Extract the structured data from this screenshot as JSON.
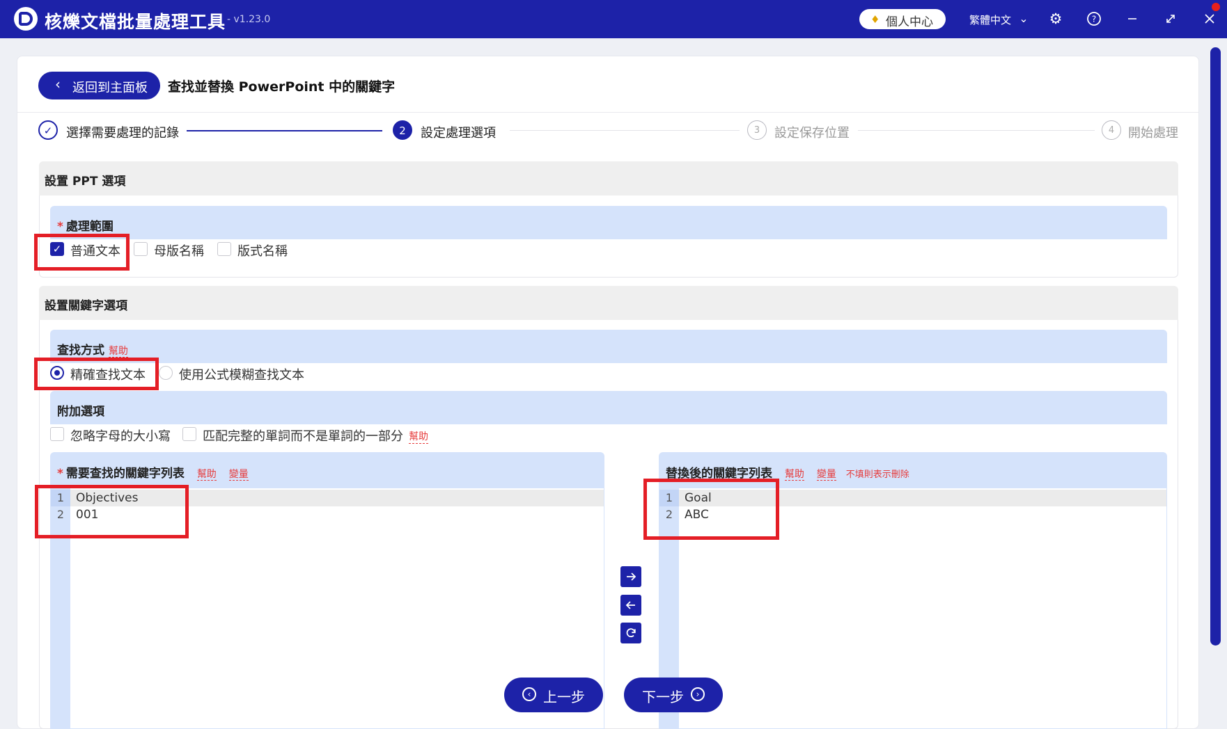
{
  "app": {
    "title": "核爍文檔批量處理工具",
    "version": "- v1.23.0",
    "vip_label": "個人中心",
    "language": "繁體中文"
  },
  "icons": {
    "vip": "diamond-icon",
    "language": "chevron-down-icon",
    "settings": "gear-icon",
    "help": "question-icon",
    "minimize": "minimize-icon",
    "maximize": "maximize-icon",
    "close": "close-icon"
  },
  "colors": {
    "brand": "#1d22a8",
    "highlight": "#e41e26",
    "section_bg": "#d5e3fb"
  },
  "header": {
    "back_label": "返回到主面板",
    "page_title": "查找並替換 PowerPoint 中的關鍵字"
  },
  "steps": [
    {
      "num": "✓",
      "label": "選擇需要處理的記錄",
      "state": "done"
    },
    {
      "num": "2",
      "label": "設定處理選項",
      "state": "active"
    },
    {
      "num": "3",
      "label": "設定保存位置",
      "state": "idle"
    },
    {
      "num": "4",
      "label": "開始處理",
      "state": "idle"
    }
  ],
  "ppt_section": {
    "title": "設置 PPT 選項",
    "scope": {
      "required": "*",
      "title": "處理範圍",
      "options": [
        {
          "label": "普通文本",
          "checked": true
        },
        {
          "label": "母版名稱",
          "checked": false
        },
        {
          "label": "版式名稱",
          "checked": false
        }
      ]
    }
  },
  "keyword_section": {
    "title": "設置關鍵字選項",
    "find_mode": {
      "title": "查找方式",
      "help": "幫助",
      "options": [
        {
          "label": "精確查找文本",
          "checked": true
        },
        {
          "label": "使用公式模糊查找文本",
          "checked": false
        }
      ]
    },
    "extra": {
      "title": "附加選項",
      "options": [
        {
          "label": "忽略字母的大小寫",
          "checked": false
        },
        {
          "label": "匹配完整的單詞而不是單詞的一部分",
          "checked": false
        }
      ],
      "help": "幫助"
    },
    "find_list": {
      "required": "*",
      "title": "需要查找的關鍵字列表",
      "help": "幫助",
      "vars": "變量",
      "lines": [
        {
          "n": "1",
          "text": "Objectives"
        },
        {
          "n": "2",
          "text": "001"
        }
      ]
    },
    "replace_list": {
      "title": "替換後的關鍵字列表",
      "help": "幫助",
      "vars": "變量",
      "note": "不填則表示刪除",
      "lines": [
        {
          "n": "1",
          "text": "Goal"
        },
        {
          "n": "2",
          "text": "ABC"
        }
      ]
    }
  },
  "footer": {
    "prev_label": "上一步",
    "next_label": "下一步"
  }
}
